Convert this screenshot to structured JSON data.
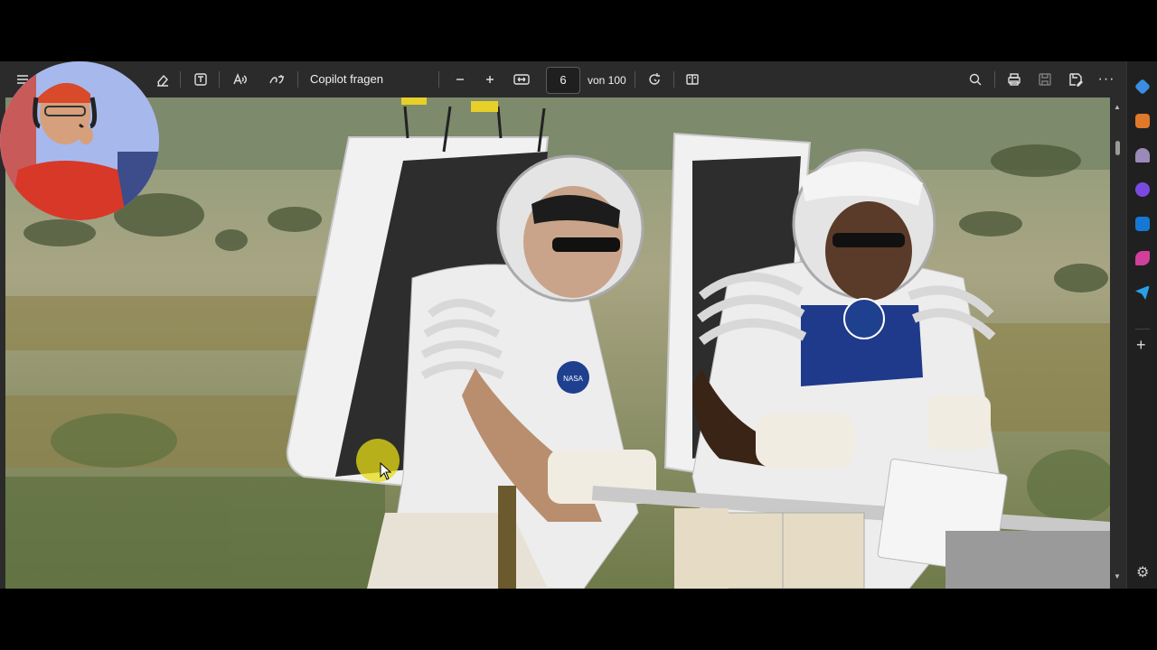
{
  "toolbar": {
    "copilot_label": "Copilot fragen",
    "current_page": "6",
    "page_count_label": "von 100"
  },
  "document": {
    "badge_text": "NASA"
  },
  "colors": {
    "toolbar_bg": "#2b2b2b",
    "sidebar_bg": "#202020",
    "highlight": "#e6dc14"
  },
  "icons": {
    "toolbar": [
      "contents-icon",
      "eraser-icon",
      "text-box-icon",
      "read-aloud-icon",
      "translate-icon",
      "zoom-out-icon",
      "zoom-in-icon",
      "fit-width-icon",
      "rotate-icon",
      "page-view-icon",
      "search-icon",
      "print-icon",
      "save-icon",
      "save-as-icon",
      "more-icon"
    ],
    "sidebar": [
      "tag-icon",
      "briefcase-icon",
      "chess-icon",
      "copilot-icon",
      "outlook-icon",
      "paint-icon",
      "send-icon",
      "add-icon",
      "settings-icon"
    ]
  }
}
